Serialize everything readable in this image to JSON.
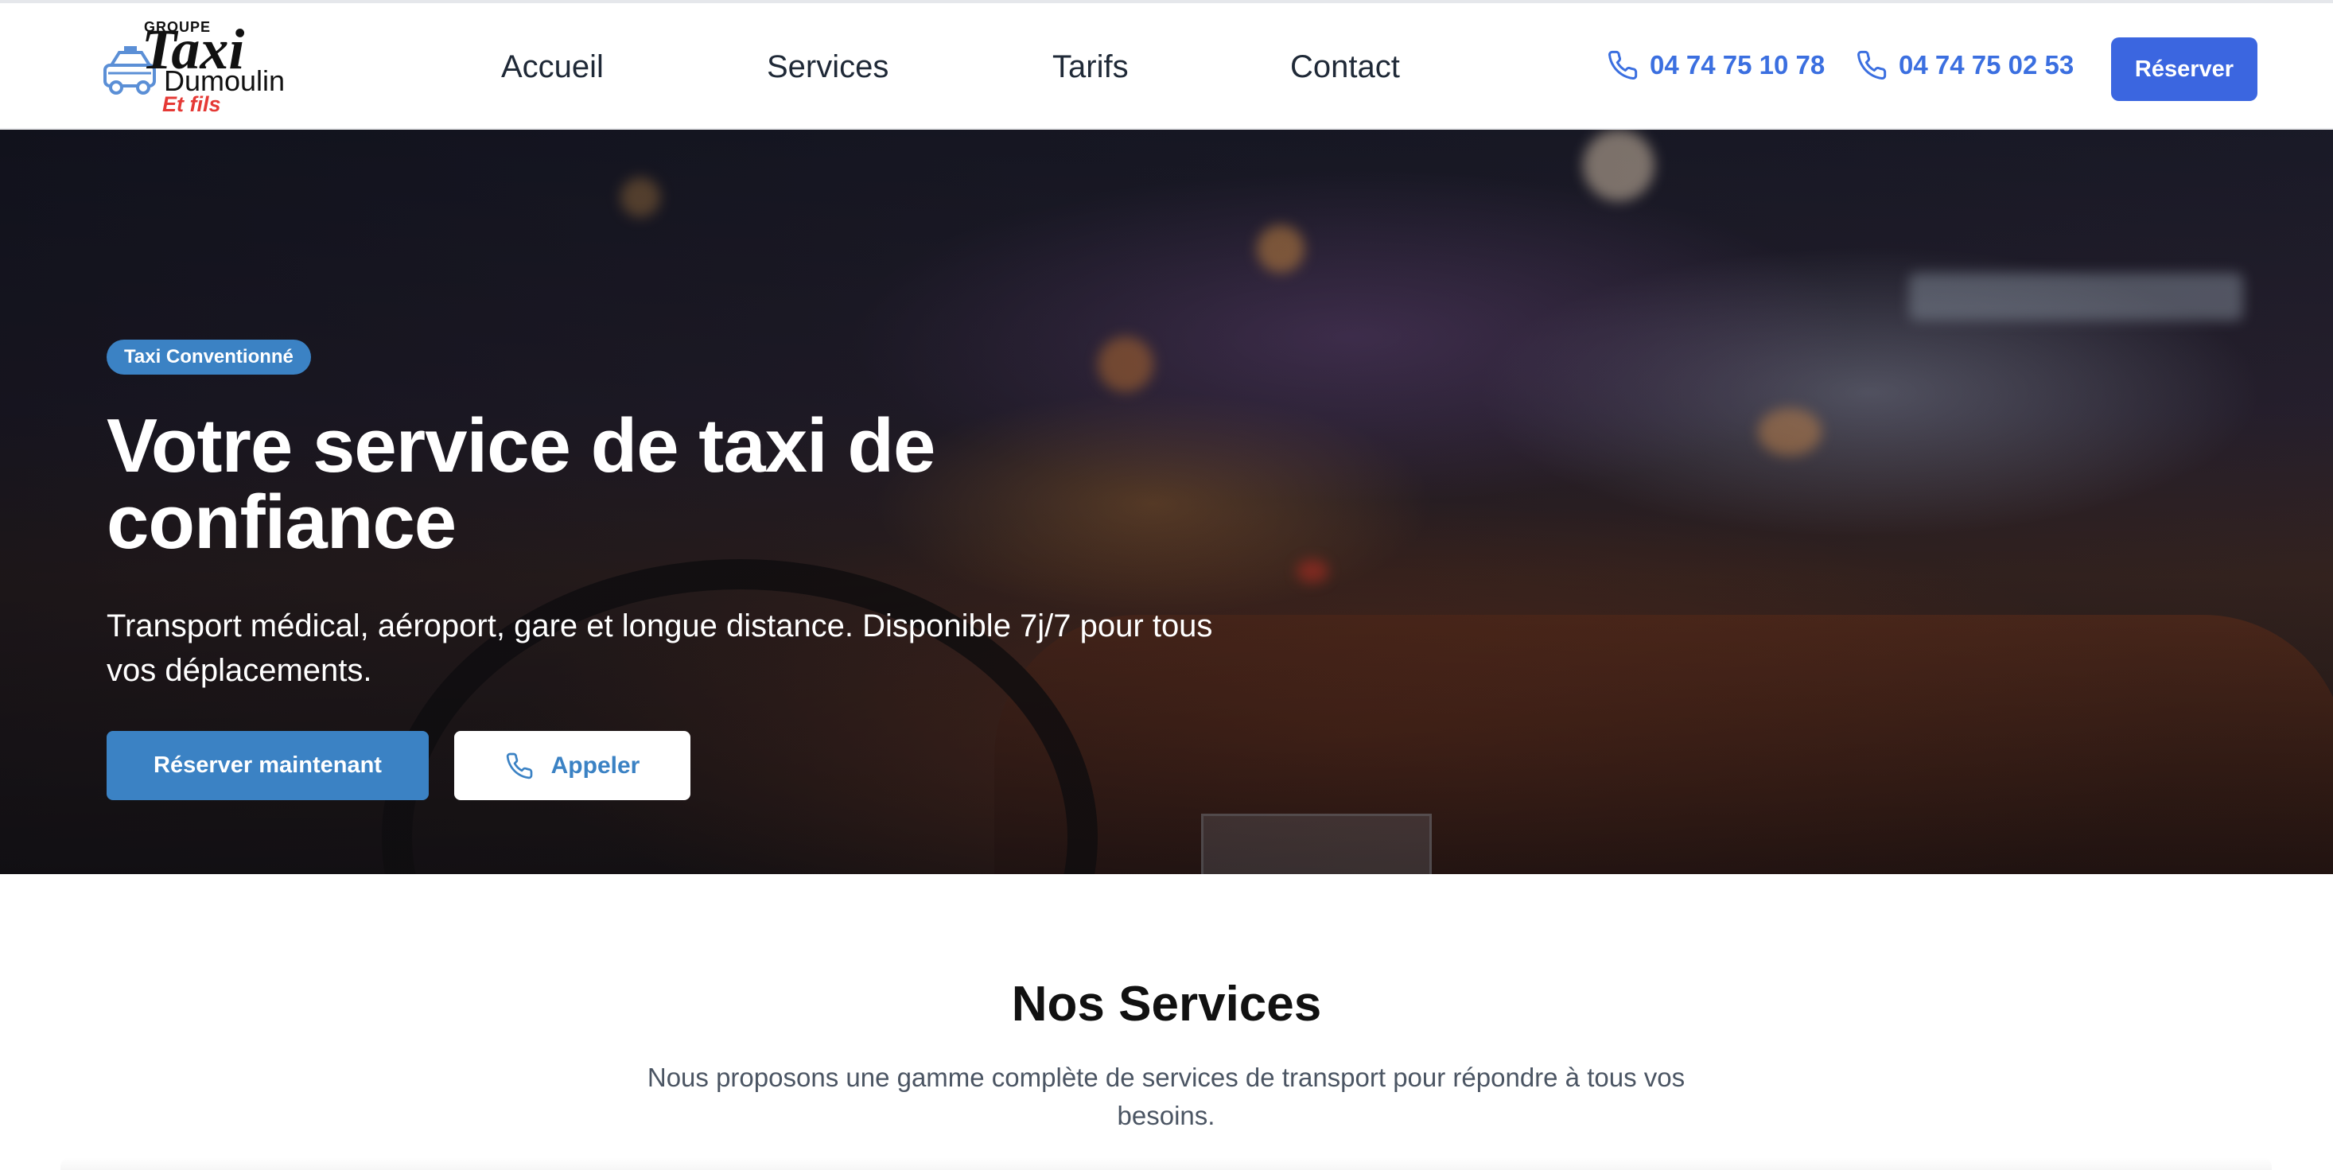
{
  "logo": {
    "groupe": "GROUPE",
    "taxi": "Taxi",
    "dumoulin": "Dumoulin",
    "et_fils": "Et fils"
  },
  "nav": {
    "items": [
      {
        "label": "Accueil"
      },
      {
        "label": "Services"
      },
      {
        "label": "Tarifs"
      },
      {
        "label": "Contact"
      }
    ]
  },
  "header": {
    "phone_1": "04 74 75 10 78",
    "phone_2": "04 74 75 02 53",
    "reserve_label": "Réserver",
    "phone_icon": "phone-icon"
  },
  "hero": {
    "badge": "Taxi Conventionné",
    "title": "Votre service de taxi de confiance",
    "subtitle": "Transport médical, aéroport, gare et longue distance. Disponible 7j/7 pour tous vos déplacements.",
    "primary_button": "Réserver maintenant",
    "secondary_button": "Appeler"
  },
  "services": {
    "title": "Nos Services",
    "description": "Nous proposons une gamme complète de services de transport pour répondre à tous vos besoins."
  },
  "colors": {
    "primary": "#3b82c4",
    "header_button": "#3b66e0",
    "phone_text": "#3b6fe0",
    "logo_accent": "#e53935"
  }
}
